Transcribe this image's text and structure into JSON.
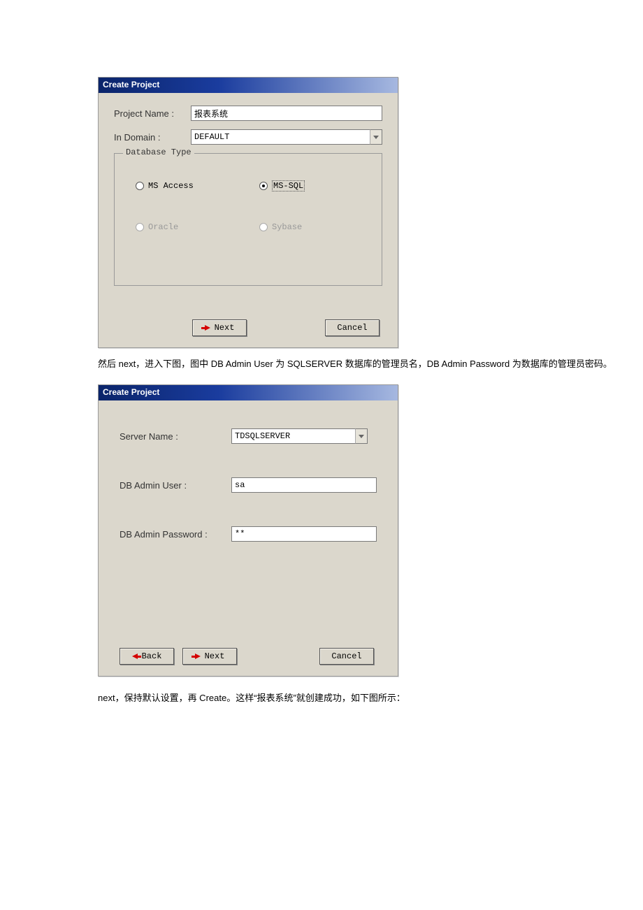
{
  "dialog1": {
    "title": "Create Project",
    "projectNameLabel": "Project Name :",
    "projectNameValue": "报表系统",
    "inDomainLabel": "In Domain :",
    "inDomainValue": "DEFAULT",
    "groupLegend": "Database Type",
    "radios": {
      "msaccess": "MS Access",
      "mssql": "MS-SQL",
      "oracle": "Oracle",
      "sybase": "Sybase"
    },
    "nextLabel": "Next",
    "cancelLabel": "Cancel"
  },
  "caption1": "然后 next，进入下图，图中 DB Admin User 为 SQLSERVER 数据库的管理员名，DB Admin Password 为数据库的管理员密码。",
  "dialog2": {
    "title": "Create Project",
    "serverNameLabel": "Server Name :",
    "serverNameValue": "TDSQLSERVER",
    "dbAdminUserLabel": "DB Admin User :",
    "dbAdminUserValue": "sa",
    "dbAdminPasswordLabel": "DB Admin Password :",
    "dbAdminPasswordValue": "**",
    "backLabel": "Back",
    "nextLabel": "Next",
    "cancelLabel": "Cancel"
  },
  "caption2": "next，保持默认设置，再 Create。这样“报表系统”就创建成功，如下图所示："
}
